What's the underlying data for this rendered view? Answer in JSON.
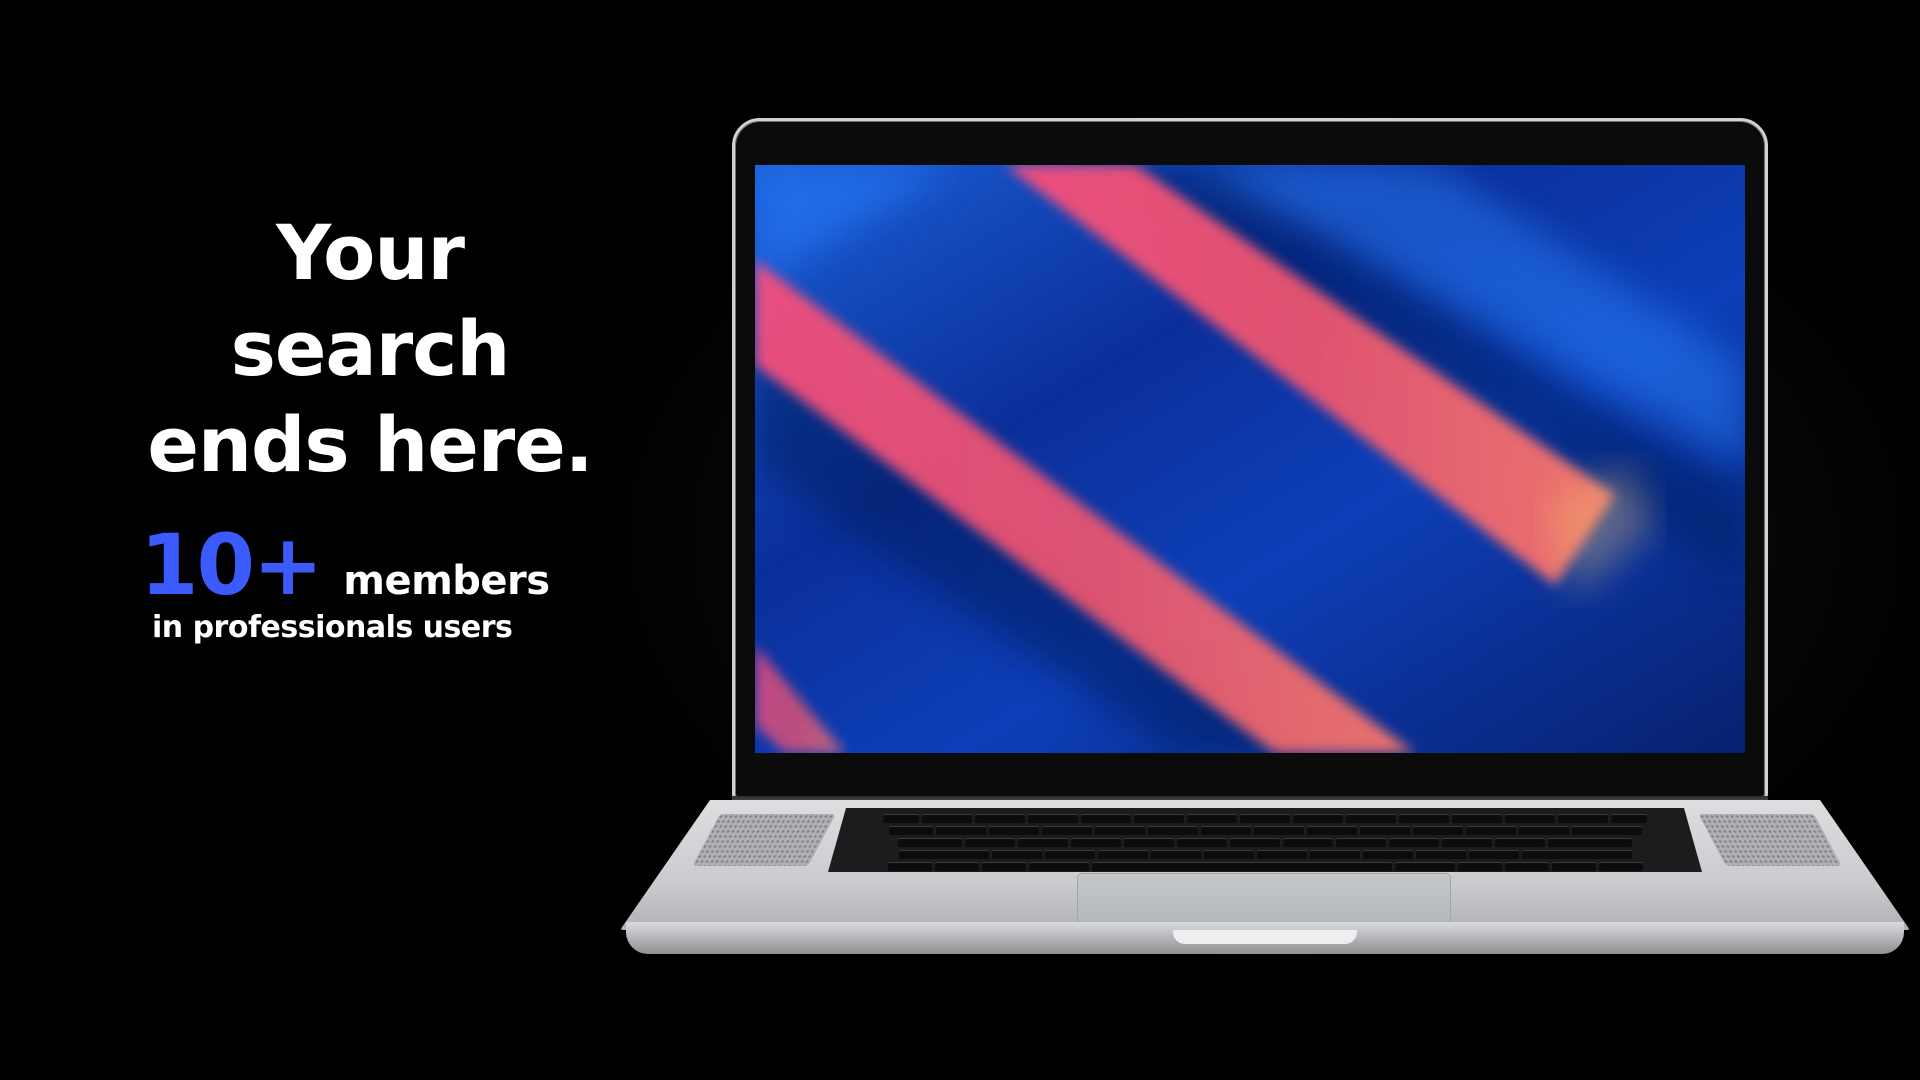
{
  "hero": {
    "headline_line1": "Your search",
    "headline_line2": "ends here."
  },
  "stats": {
    "number": "10+",
    "label": "members",
    "sub": "in professionals users"
  },
  "colors": {
    "background": "#000000",
    "accent": "#3b5bff",
    "text": "#ffffff",
    "screen_blue": "#0b2a8a",
    "screen_pink": "#f2566e"
  },
  "device": {
    "type": "laptop-icon",
    "wallpaper": "abstract-blue-pink-diagonal-stripes"
  }
}
